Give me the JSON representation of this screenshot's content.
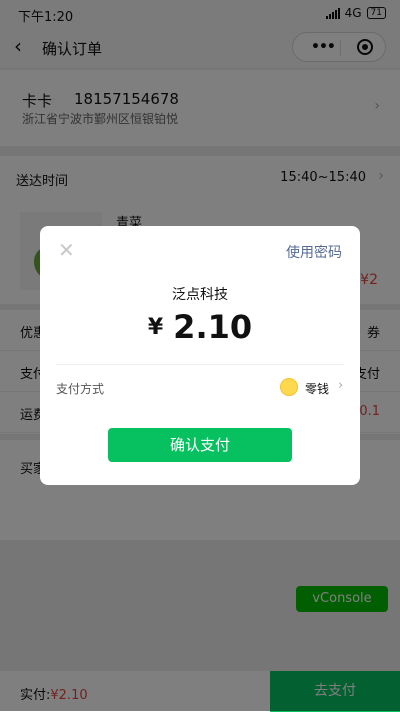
{
  "status_bar": {
    "time": "下午1:20",
    "network": "4G",
    "battery": "71"
  },
  "nav": {
    "title": "确认订单"
  },
  "address": {
    "name": "卡卡",
    "phone": "18157154678",
    "line": "浙江省宁波市鄞州区恒银铂悦"
  },
  "delivery": {
    "label": "送达时间",
    "value": "15:40~15:40"
  },
  "product": {
    "name": "青菜",
    "price": "¥2"
  },
  "rows": [
    {
      "label": "优惠",
      "value": "券"
    },
    {
      "label": "支付",
      "value": "支付"
    },
    {
      "label": "运费",
      "value": "0.1"
    }
  ],
  "buyer": {
    "label": "买家"
  },
  "vconsole": "vConsole",
  "bottom": {
    "paid_label": "实付:",
    "paid_amount": "¥2.10",
    "pay_button": "去支付"
  },
  "modal": {
    "use_password": "使用密码",
    "merchant": "泛点科技",
    "currency": "¥",
    "amount": "2.10",
    "payment_method_label": "支付方式",
    "payment_method_value": "零钱",
    "confirm_button": "确认支付"
  },
  "colors": {
    "wechat_green": "#07c160",
    "price_red": "#e64340",
    "link_blue": "#576b95"
  }
}
